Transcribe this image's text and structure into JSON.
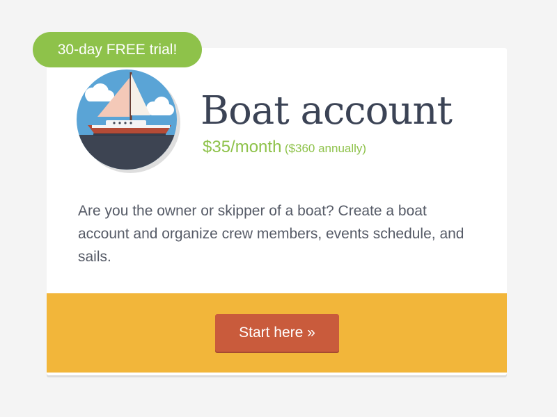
{
  "promo": {
    "badge": "30-day FREE trial!"
  },
  "account": {
    "icon": "sailboat-icon",
    "title": "Boat account",
    "price_monthly": "$35/month",
    "price_annual": "($360 annually)",
    "description": "Are you the owner or skipper of a boat? Create a boat account and organize crew members, events schedule, and sails."
  },
  "cta": {
    "label": "Start here »"
  },
  "colors": {
    "accent_green": "#8ec24a",
    "band_yellow": "#f2b63a",
    "button_red": "#c95b3c",
    "title_text": "#3b4355"
  }
}
